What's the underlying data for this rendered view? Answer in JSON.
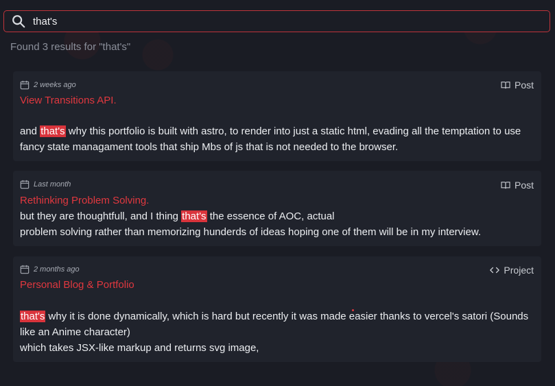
{
  "search": {
    "value": "that's",
    "results_text": "Found 3 results for \"that's\""
  },
  "results": [
    {
      "date": "2 weeks ago",
      "type": "Post",
      "type_icon": "book-icon",
      "title": "View Transitions API.",
      "body_parts": [
        {
          "text": "and "
        },
        {
          "text": "that's",
          "highlight": true
        },
        {
          "text": " why this portfolio is built with astro, to render into just a static html, evading all the temptation to use fancy state managament tools that ship Mbs of js that is not needed to the browser."
        }
      ]
    },
    {
      "date": "Last month",
      "type": "Post",
      "type_icon": "book-icon",
      "title": "Rethinking Problem Solving.",
      "body_parts": [
        {
          "text": "but they are thoughtfull, and I thing "
        },
        {
          "text": "that's",
          "highlight": true
        },
        {
          "text": " the essence of AOC, actual\nproblem solving rather than memorizing hunderds of ideas hoping one of them will be in my interview."
        }
      ]
    },
    {
      "date": "2 months ago",
      "type": "Project",
      "type_icon": "code-icon",
      "title": "Personal Blog & Portfolio",
      "body_parts": [
        {
          "text": "that's",
          "highlight": true
        },
        {
          "text": " why it is done dynamically, which is hard but recently it was made easier thanks to vercel's satori (Sounds like an Anime character)\nwhich takes JSX-like markup and returns svg image,"
        }
      ]
    }
  ],
  "colors": {
    "accent": "#e0383f",
    "highlight": "#d9343c",
    "card": "#20232c",
    "background": "#1a1c24"
  }
}
